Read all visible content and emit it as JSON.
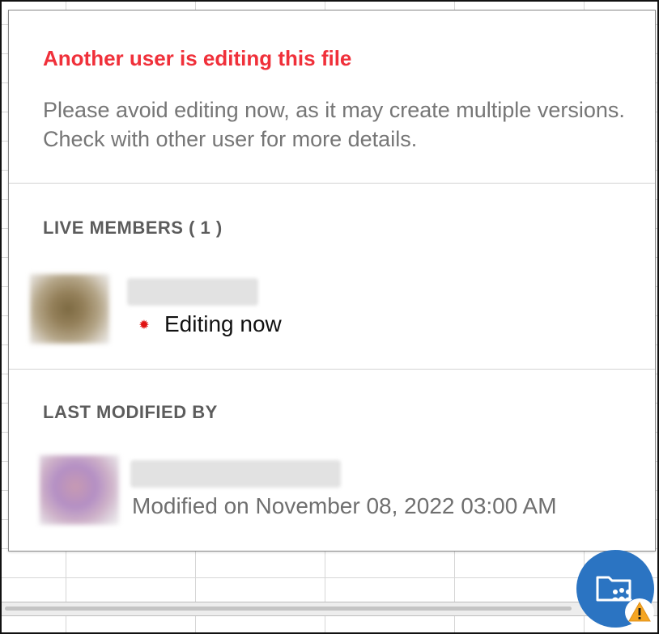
{
  "warning": {
    "title": "Another user is editing this file",
    "message": "Please avoid editing now, as it may create multiple versions. Check with other user for more details."
  },
  "live_members": {
    "heading": "LIVE MEMBERS ( 1 )",
    "members": [
      {
        "status": "Editing now",
        "status_color": "#e01111"
      }
    ]
  },
  "last_modified": {
    "heading": "LAST MODIFIED BY",
    "modified_text": "Modified on November 08, 2022 03:00 AM"
  },
  "colors": {
    "warning_title": "#f0303a",
    "fab_background": "#2b74c2",
    "warning_badge": "#f5a623"
  },
  "icons": {
    "fab": "shared-folder-icon",
    "badge": "warning-icon"
  }
}
